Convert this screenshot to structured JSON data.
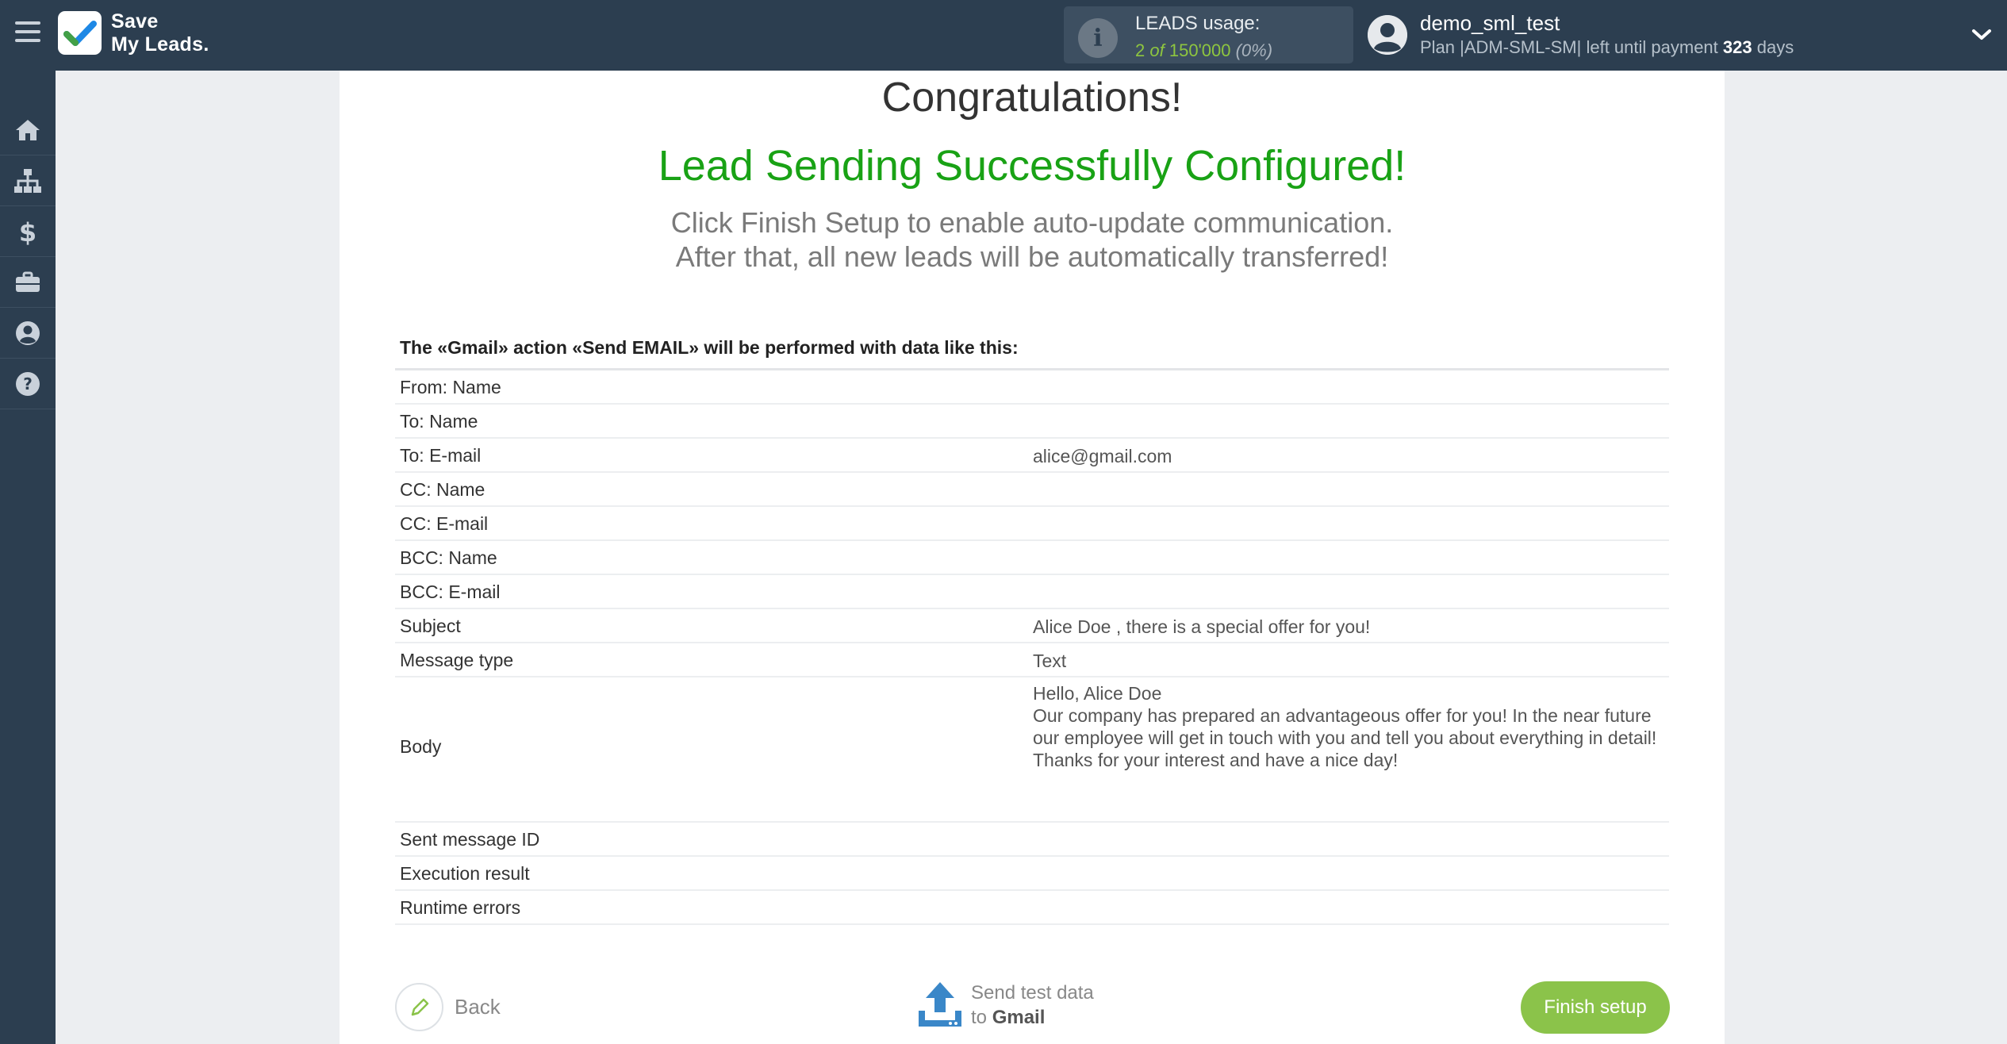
{
  "app": {
    "logo_line1": "Save",
    "logo_line2": "My Leads."
  },
  "usage": {
    "title": "LEADS usage:",
    "used": "2",
    "of": "of",
    "total": "150'000",
    "percent": "(0%)"
  },
  "user": {
    "name": "demo_sml_test",
    "plan_prefix": "Plan |ADM-SML-SM| left until payment",
    "days_left": "323",
    "days_unit": "days"
  },
  "sidebar": {
    "items": [
      {
        "icon": "home-icon"
      },
      {
        "icon": "sitemap-icon"
      },
      {
        "icon": "dollar-icon"
      },
      {
        "icon": "briefcase-icon"
      },
      {
        "icon": "user-circle-icon"
      },
      {
        "icon": "help-icon"
      }
    ]
  },
  "main": {
    "congrats": "Congratulations!",
    "success": "Lead Sending Successfully Configured!",
    "info_line1": "Click Finish Setup to enable auto-update communication.",
    "info_line2": "After that, all new leads will be automatically transferred!",
    "table_title": "The «Gmail» action «Send EMAIL» will be performed with data like this:",
    "rows": [
      {
        "key": "From: Name",
        "value": ""
      },
      {
        "key": "To: Name",
        "value": ""
      },
      {
        "key": "To: E-mail",
        "value": "alice@gmail.com"
      },
      {
        "key": "CC: Name",
        "value": ""
      },
      {
        "key": "CC: E-mail",
        "value": ""
      },
      {
        "key": "BCC: Name",
        "value": ""
      },
      {
        "key": "BCC: E-mail",
        "value": ""
      },
      {
        "key": "Subject",
        "value": "Alice Doe , there is a special offer for you!"
      },
      {
        "key": "Message type",
        "value": "Text"
      }
    ],
    "body": {
      "key": "Body",
      "line1": "Hello, Alice Doe",
      "line2": "Our company has prepared an advantageous offer for you! In the near future our employee will get in touch with you and tell you about everything in detail! Thanks for your interest and have a nice day!"
    },
    "rows_after": [
      {
        "key": "Sent message ID",
        "value": ""
      },
      {
        "key": "Execution result",
        "value": ""
      },
      {
        "key": "Runtime errors",
        "value": ""
      }
    ]
  },
  "footer": {
    "back_label": "Back",
    "test_line1": "Send test data",
    "test_to": "to",
    "test_service": "Gmail",
    "finish_label": "Finish setup"
  },
  "colors": {
    "header_bg": "#2c3e50",
    "success_green": "#19a215",
    "finish_button": "#8bc34a",
    "usage_green": "#8ec63f",
    "upload_icon_blue": "#3a87c8"
  }
}
